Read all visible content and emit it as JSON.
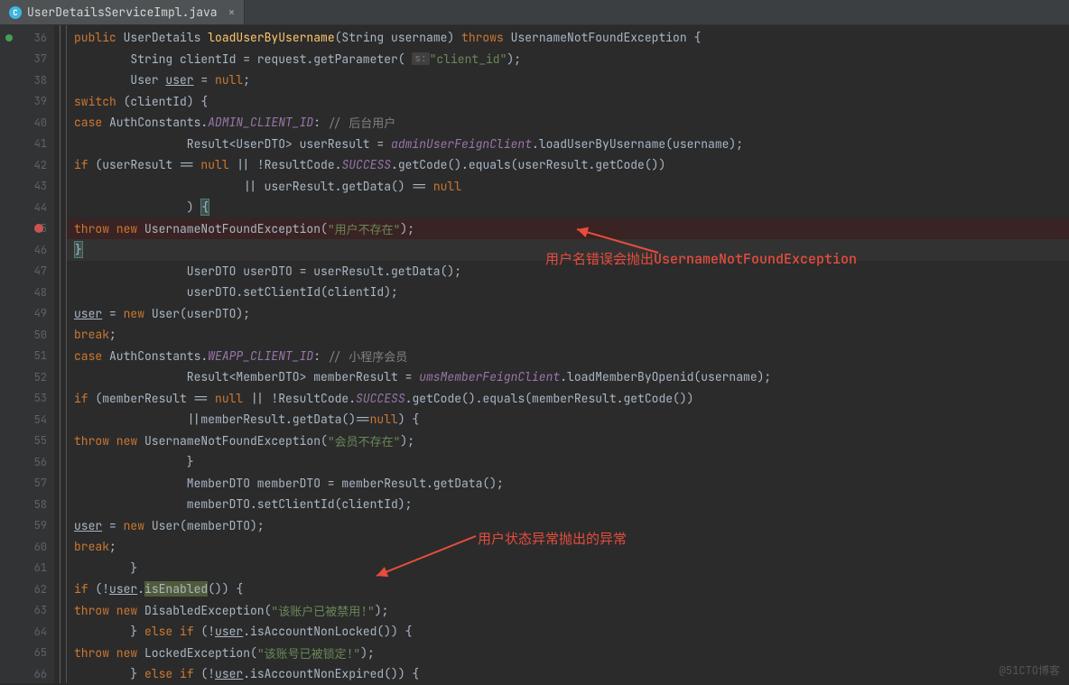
{
  "tab": {
    "filename": "UserDetailsServiceImpl.java",
    "icon_letter": "C"
  },
  "watermark": "@51CTO博客",
  "gutter_start": 36,
  "annotations": {
    "a1": "用户名错误会抛出UsernameNotFoundException",
    "a2": "用户状态异常抛出的异常"
  },
  "lines": [
    {
      "n": 36,
      "mark": "green",
      "html": "    <span class='kw'>public</span> UserDetails <span class='method'>loadUserByUsername</span>(String username) <span class='kw'>throws</span> UsernameNotFoundException {"
    },
    {
      "n": 37,
      "html": "        String clientId = request.getParameter( <span class='param-hint'>s:</span> <span class='str'>\"client_id\"</span>);"
    },
    {
      "n": 38,
      "html": "        User <span class='underline'>user</span> = <span class='kw'>null</span>;"
    },
    {
      "n": 39,
      "html": "        <span class='kw'>switch</span> (clientId) {"
    },
    {
      "n": 40,
      "html": "            <span class='kw'>case</span> AuthConstants.<span class='static'>ADMIN_CLIENT_ID</span>: <span class='comment'>// 后台用户</span>"
    },
    {
      "n": 41,
      "html": "                Result&lt;UserDTO&gt; userResult = <span class='static'>adminUserFeignClient</span>.loadUserByUsername(username);"
    },
    {
      "n": 42,
      "html": "                <span class='kw'>if</span> (userResult == <span class='kw'>null</span> || !ResultCode.<span class='static'>SUCCESS</span>.getCode().equals(userResult.getCode())"
    },
    {
      "n": 43,
      "html": "                        || userResult.getData() == <span class='kw'>null</span>"
    },
    {
      "n": 44,
      "html": "                ) <span class='bracket-hl'>{</span>"
    },
    {
      "n": 45,
      "bp": true,
      "cls": "hl-bp",
      "html": "                    <span class='kw'>throw new</span> UsernameNotFoundException(<span class='str'>\"用户不存在\"</span>);"
    },
    {
      "n": 46,
      "cls": "hl-caret",
      "html": "                <span class='bracket-hl'>}</span>"
    },
    {
      "n": 47,
      "html": "                UserDTO userDTO = userResult.getData();"
    },
    {
      "n": 48,
      "html": "                userDTO.setClientId(clientId);"
    },
    {
      "n": 49,
      "html": "                <span class='underline'>user</span> = <span class='kw'>new</span> User(userDTO);"
    },
    {
      "n": 50,
      "html": "                <span class='kw'>break</span>;"
    },
    {
      "n": 51,
      "html": "            <span class='kw'>case</span> AuthConstants.<span class='static'>WEAPP_CLIENT_ID</span>: <span class='comment'>// 小程序会员</span>"
    },
    {
      "n": 52,
      "html": "                Result&lt;MemberDTO&gt; memberResult = <span class='static'>umsMemberFeignClient</span>.loadMemberByOpenid(username);"
    },
    {
      "n": 53,
      "html": "                <span class='kw'>if</span> (memberResult == <span class='kw'>null</span> || !ResultCode.<span class='static'>SUCCESS</span>.getCode().equals(memberResult.getCode())"
    },
    {
      "n": 54,
      "html": "                ||memberResult.getData()==<span class='kw'>null</span>) {"
    },
    {
      "n": 55,
      "html": "                    <span class='kw'>throw new</span> UsernameNotFoundException(<span class='str'>\"会员不存在\"</span>);"
    },
    {
      "n": 56,
      "html": "                }"
    },
    {
      "n": 57,
      "html": "                MemberDTO memberDTO = memberResult.getData();"
    },
    {
      "n": 58,
      "html": "                memberDTO.setClientId(clientId);"
    },
    {
      "n": 59,
      "html": "                <span class='underline'>user</span> = <span class='kw'>new</span> User(memberDTO);"
    },
    {
      "n": 60,
      "html": "                <span class='kw'>break</span>;"
    },
    {
      "n": 61,
      "html": "        }"
    },
    {
      "n": 62,
      "html": "        <span class='kw'>if</span> (!<span class='underline'>user</span>.<span class='method-hl'>isEnabled</span>()) {"
    },
    {
      "n": 63,
      "html": "            <span class='kw'>throw new</span> DisabledException(<span class='str'>\"该账户已被禁用!\"</span>);"
    },
    {
      "n": 64,
      "html": "        } <span class='kw'>else if</span> (!<span class='underline'>user</span>.isAccountNonLocked()) {"
    },
    {
      "n": 65,
      "html": "            <span class='kw'>throw new</span> LockedException(<span class='str'>\"该账号已被锁定!\"</span>);"
    },
    {
      "n": 66,
      "html": "        } <span class='kw'>else if</span> (!<span class='underline'>user</span>.isAccountNonExpired()) {"
    }
  ]
}
